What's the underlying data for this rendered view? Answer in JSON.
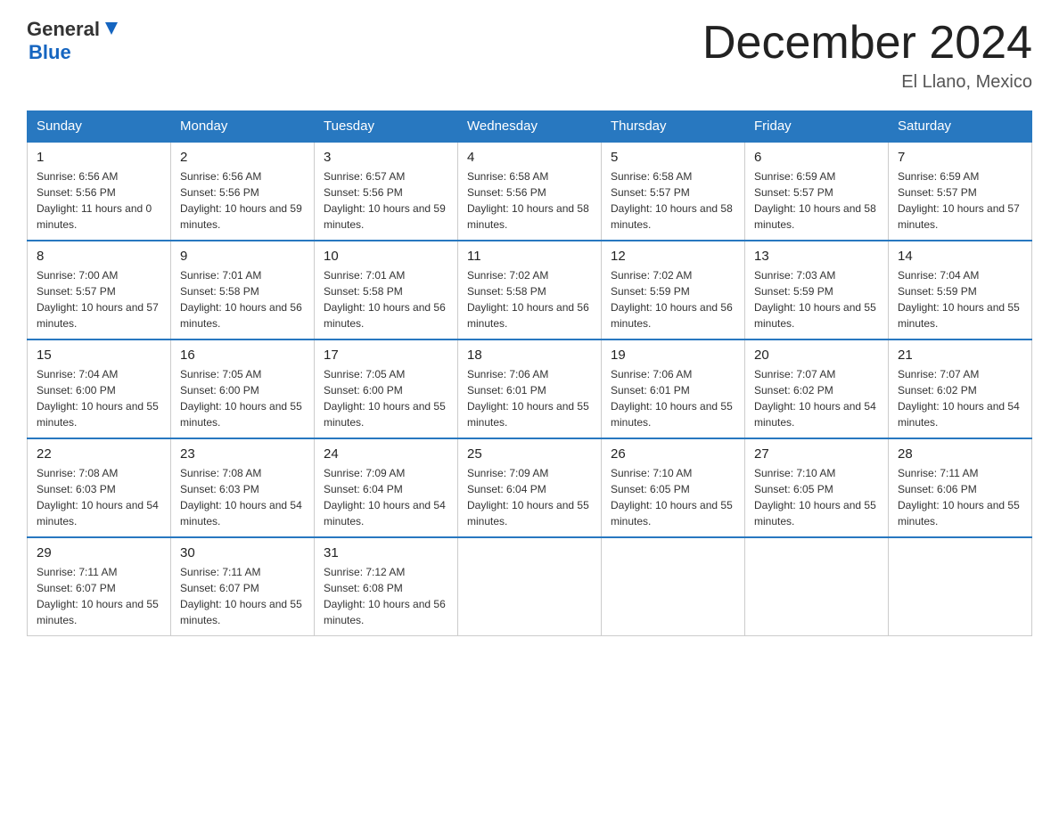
{
  "header": {
    "logo_general": "General",
    "logo_blue": "Blue",
    "title": "December 2024",
    "subtitle": "El Llano, Mexico"
  },
  "days_of_week": [
    "Sunday",
    "Monday",
    "Tuesday",
    "Wednesday",
    "Thursday",
    "Friday",
    "Saturday"
  ],
  "weeks": [
    [
      {
        "day": "1",
        "sunrise": "6:56 AM",
        "sunset": "5:56 PM",
        "daylight": "11 hours and 0 minutes."
      },
      {
        "day": "2",
        "sunrise": "6:56 AM",
        "sunset": "5:56 PM",
        "daylight": "10 hours and 59 minutes."
      },
      {
        "day": "3",
        "sunrise": "6:57 AM",
        "sunset": "5:56 PM",
        "daylight": "10 hours and 59 minutes."
      },
      {
        "day": "4",
        "sunrise": "6:58 AM",
        "sunset": "5:56 PM",
        "daylight": "10 hours and 58 minutes."
      },
      {
        "day": "5",
        "sunrise": "6:58 AM",
        "sunset": "5:57 PM",
        "daylight": "10 hours and 58 minutes."
      },
      {
        "day": "6",
        "sunrise": "6:59 AM",
        "sunset": "5:57 PM",
        "daylight": "10 hours and 58 minutes."
      },
      {
        "day": "7",
        "sunrise": "6:59 AM",
        "sunset": "5:57 PM",
        "daylight": "10 hours and 57 minutes."
      }
    ],
    [
      {
        "day": "8",
        "sunrise": "7:00 AM",
        "sunset": "5:57 PM",
        "daylight": "10 hours and 57 minutes."
      },
      {
        "day": "9",
        "sunrise": "7:01 AM",
        "sunset": "5:58 PM",
        "daylight": "10 hours and 56 minutes."
      },
      {
        "day": "10",
        "sunrise": "7:01 AM",
        "sunset": "5:58 PM",
        "daylight": "10 hours and 56 minutes."
      },
      {
        "day": "11",
        "sunrise": "7:02 AM",
        "sunset": "5:58 PM",
        "daylight": "10 hours and 56 minutes."
      },
      {
        "day": "12",
        "sunrise": "7:02 AM",
        "sunset": "5:59 PM",
        "daylight": "10 hours and 56 minutes."
      },
      {
        "day": "13",
        "sunrise": "7:03 AM",
        "sunset": "5:59 PM",
        "daylight": "10 hours and 55 minutes."
      },
      {
        "day": "14",
        "sunrise": "7:04 AM",
        "sunset": "5:59 PM",
        "daylight": "10 hours and 55 minutes."
      }
    ],
    [
      {
        "day": "15",
        "sunrise": "7:04 AM",
        "sunset": "6:00 PM",
        "daylight": "10 hours and 55 minutes."
      },
      {
        "day": "16",
        "sunrise": "7:05 AM",
        "sunset": "6:00 PM",
        "daylight": "10 hours and 55 minutes."
      },
      {
        "day": "17",
        "sunrise": "7:05 AM",
        "sunset": "6:00 PM",
        "daylight": "10 hours and 55 minutes."
      },
      {
        "day": "18",
        "sunrise": "7:06 AM",
        "sunset": "6:01 PM",
        "daylight": "10 hours and 55 minutes."
      },
      {
        "day": "19",
        "sunrise": "7:06 AM",
        "sunset": "6:01 PM",
        "daylight": "10 hours and 55 minutes."
      },
      {
        "day": "20",
        "sunrise": "7:07 AM",
        "sunset": "6:02 PM",
        "daylight": "10 hours and 54 minutes."
      },
      {
        "day": "21",
        "sunrise": "7:07 AM",
        "sunset": "6:02 PM",
        "daylight": "10 hours and 54 minutes."
      }
    ],
    [
      {
        "day": "22",
        "sunrise": "7:08 AM",
        "sunset": "6:03 PM",
        "daylight": "10 hours and 54 minutes."
      },
      {
        "day": "23",
        "sunrise": "7:08 AM",
        "sunset": "6:03 PM",
        "daylight": "10 hours and 54 minutes."
      },
      {
        "day": "24",
        "sunrise": "7:09 AM",
        "sunset": "6:04 PM",
        "daylight": "10 hours and 54 minutes."
      },
      {
        "day": "25",
        "sunrise": "7:09 AM",
        "sunset": "6:04 PM",
        "daylight": "10 hours and 55 minutes."
      },
      {
        "day": "26",
        "sunrise": "7:10 AM",
        "sunset": "6:05 PM",
        "daylight": "10 hours and 55 minutes."
      },
      {
        "day": "27",
        "sunrise": "7:10 AM",
        "sunset": "6:05 PM",
        "daylight": "10 hours and 55 minutes."
      },
      {
        "day": "28",
        "sunrise": "7:11 AM",
        "sunset": "6:06 PM",
        "daylight": "10 hours and 55 minutes."
      }
    ],
    [
      {
        "day": "29",
        "sunrise": "7:11 AM",
        "sunset": "6:07 PM",
        "daylight": "10 hours and 55 minutes."
      },
      {
        "day": "30",
        "sunrise": "7:11 AM",
        "sunset": "6:07 PM",
        "daylight": "10 hours and 55 minutes."
      },
      {
        "day": "31",
        "sunrise": "7:12 AM",
        "sunset": "6:08 PM",
        "daylight": "10 hours and 56 minutes."
      },
      null,
      null,
      null,
      null
    ]
  ]
}
